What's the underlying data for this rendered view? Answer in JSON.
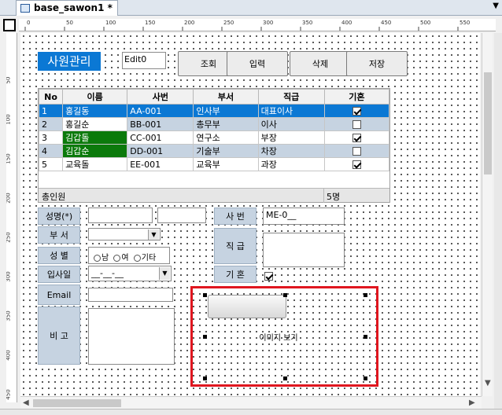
{
  "tab": {
    "title": "base_sawon1 *",
    "icon": "form-icon"
  },
  "ruler": {
    "h_labels": [
      "0",
      "50",
      "100",
      "150",
      "200",
      "250",
      "300",
      "350",
      "400",
      "450",
      "500",
      "550"
    ],
    "v_labels": [
      "50",
      "100",
      "150",
      "200",
      "250",
      "300",
      "350",
      "400",
      "450"
    ]
  },
  "form": {
    "title": "사원관리",
    "edit0": "Edit0",
    "buttons": {
      "search": "조회",
      "insert": "입력",
      "delete": "삭제",
      "save": "저장"
    }
  },
  "grid": {
    "columns": [
      "No",
      "이름",
      "사번",
      "부서",
      "직급",
      "기혼"
    ],
    "rows": [
      {
        "no": "1",
        "name": "홍길동",
        "id": "AA-001",
        "dept": "인사부",
        "rank": "대표이사",
        "married": true
      },
      {
        "no": "2",
        "name": "홍길순",
        "id": "BB-001",
        "dept": "총무부",
        "rank": "이사",
        "married": false
      },
      {
        "no": "3",
        "name": "김갑돌",
        "id": "CC-001",
        "dept": "연구소",
        "rank": "부장",
        "married": true
      },
      {
        "no": "4",
        "name": "김갑순",
        "id": "DD-001",
        "dept": "기술부",
        "rank": "차장",
        "married": false
      },
      {
        "no": "5",
        "name": "교육돌",
        "id": "EE-001",
        "dept": "교육부",
        "rank": "과장",
        "married": true
      }
    ],
    "footer_label": "총인원",
    "footer_count": "5명"
  },
  "detail": {
    "name_label": "성명(*)",
    "dept_label": "부 서",
    "gender_label": "성 별",
    "gender_options": [
      "남",
      "여",
      "기타"
    ],
    "join_label": "입사일",
    "join_value": "__-__-__",
    "email_label": "Email",
    "note_label": "비 고",
    "empno_label": "사 번",
    "empno_value": "ME-0__",
    "rank_label": "직 급",
    "married_label": "기 혼",
    "image_label": "이미지 보기"
  },
  "colors": {
    "title_bg": "#0b78d4",
    "selected_row": "#0b78d4",
    "alt_row": "#c6d3e1",
    "highlight_box": "#e0161f",
    "green_cell": "#0b7a0b"
  }
}
